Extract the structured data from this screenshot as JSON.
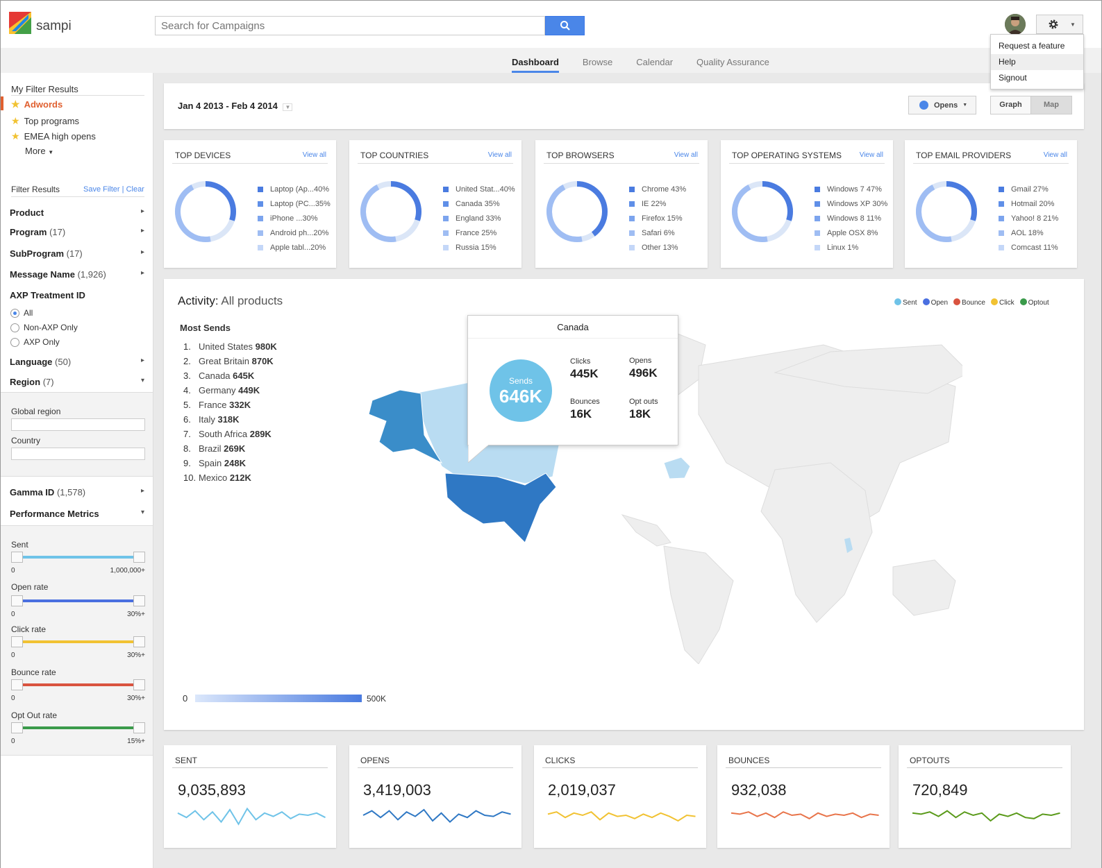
{
  "app": {
    "name": "sampi"
  },
  "search": {
    "placeholder": "Search for Campaigns"
  },
  "user_menu": {
    "items": [
      "Request a feature",
      "Help",
      "Signout"
    ]
  },
  "nav": {
    "tabs": [
      "Dashboard",
      "Browse",
      "Calendar",
      "Quality Assurance"
    ],
    "active": "Dashboard"
  },
  "sidebar": {
    "my_filters_title": "My Filter Results",
    "my_filters": [
      "Adwords",
      "Top programs",
      "EMEA high opens"
    ],
    "more": "More",
    "filter_results_title": "Filter Results",
    "save_filter": "Save Filter",
    "clear": "Clear",
    "facets": [
      {
        "name": "Product",
        "count": ""
      },
      {
        "name": "Program",
        "count": "(17)"
      },
      {
        "name": "SubProgram",
        "count": "(17)"
      },
      {
        "name": "Message Name",
        "count": "(1,926)"
      }
    ],
    "axp_title": "AXP Treatment ID",
    "axp_options": [
      "All",
      "Non-AXP Only",
      "AXP Only"
    ],
    "language": {
      "name": "Language",
      "count": "(50)"
    },
    "region": {
      "name": "Region",
      "count": "(7)"
    },
    "global_region_label": "Global region",
    "country_label": "Country",
    "gamma": {
      "name": "Gamma ID",
      "count": "(1,578)"
    },
    "performance_title": "Performance Metrics",
    "sliders": [
      {
        "label": "Sent",
        "min": "0",
        "max": "1,000,000+",
        "color": "#6fc3e8"
      },
      {
        "label": "Open rate",
        "min": "0",
        "max": "30%+",
        "color": "#4a6fe0"
      },
      {
        "label": "Click rate",
        "min": "0",
        "max": "30%+",
        "color": "#f1c232"
      },
      {
        "label": "Bounce rate",
        "min": "0",
        "max": "30%+",
        "color": "#d9533f"
      },
      {
        "label": "Opt Out rate",
        "min": "0",
        "max": "15%+",
        "color": "#3a9a4a"
      }
    ]
  },
  "toolbar": {
    "date_range": "Jan 4 2013 - Feb 4 2014",
    "metric": "Opens",
    "view_graph": "Graph",
    "view_map": "Map"
  },
  "panels": [
    {
      "title": "TOP DEVICES",
      "view_all": "View all",
      "items": [
        "Laptop (Ap...40%",
        "Laptop (PC...35%",
        "iPhone ...30%",
        "Android ph...20%",
        "Apple tabl...20%"
      ]
    },
    {
      "title": "TOP COUNTRIES",
      "view_all": "View all",
      "items": [
        "United Stat...40%",
        "Canada 35%",
        "England 33%",
        "France 25%",
        "Russia 15%"
      ]
    },
    {
      "title": "TOP BROWSERS",
      "view_all": "View all",
      "items": [
        "Chrome  43%",
        "IE 22%",
        "Firefox 15%",
        "Safari 6%",
        "Other 13%"
      ]
    },
    {
      "title": "TOP OPERATING SYSTEMS",
      "view_all": "View all",
      "items": [
        "Windows 7 47%",
        "Windows XP 30%",
        "Windows 8 11%",
        "Apple OSX 8%",
        "Linux 1%"
      ]
    },
    {
      "title": "TOP EMAIL PROVIDERS",
      "view_all": "View all",
      "items": [
        "Gmail 27%",
        "Hotmail 20%",
        "Yahoo! 8 21%",
        "AOL 18%",
        "Comcast 11%"
      ]
    }
  ],
  "legend_colors": [
    "#4a7be0",
    "#5f8fe8",
    "#7ca4ee",
    "#9fbdf3",
    "#c4d7f8"
  ],
  "activity": {
    "title_prefix": "Activity:",
    "title_value": "All products",
    "legend": [
      {
        "name": "Sent",
        "color": "#6fc3e8"
      },
      {
        "name": "Open",
        "color": "#4a6fe0"
      },
      {
        "name": "Bounce",
        "color": "#d9533f"
      },
      {
        "name": "Click",
        "color": "#f1c232"
      },
      {
        "name": "Optout",
        "color": "#3a9a4a"
      }
    ],
    "most_sends_title": "Most Sends",
    "most_sends": [
      {
        "rank": "1.",
        "name": "United States",
        "value": "980K"
      },
      {
        "rank": "2.",
        "name": "Great Britain",
        "value": "870K"
      },
      {
        "rank": "3.",
        "name": "Canada",
        "value": "645K"
      },
      {
        "rank": "4.",
        "name": "Germany",
        "value": "449K"
      },
      {
        "rank": "5.",
        "name": "France",
        "value": "332K"
      },
      {
        "rank": "6.",
        "name": "Italy",
        "value": "318K"
      },
      {
        "rank": "7.",
        "name": "South Africa",
        "value": "289K"
      },
      {
        "rank": "8.",
        "name": "Brazil",
        "value": "269K"
      },
      {
        "rank": "9.",
        "name": "Spain",
        "value": "248K"
      },
      {
        "rank": "10.",
        "name": "Mexico",
        "value": "212K"
      }
    ],
    "tooltip": {
      "country": "Canada",
      "sends_label": "Sends",
      "sends": "646K",
      "clicks_label": "Clicks",
      "clicks": "445K",
      "opens_label": "Opens",
      "opens": "496K",
      "bounces_label": "Bounces",
      "bounces": "16K",
      "optouts_label": "Opt outs",
      "optouts": "18K"
    },
    "scale_min": "0",
    "scale_max": "500K"
  },
  "kpis": [
    {
      "title": "SENT",
      "value": "9,035,893",
      "color": "#6fc3e8"
    },
    {
      "title": "OPENS",
      "value": "3,419,003",
      "color": "#2f78c4"
    },
    {
      "title": "CLICKS",
      "value": "2,019,037",
      "color": "#f1c232"
    },
    {
      "title": "BOUNCES",
      "value": "932,038",
      "color": "#e8744a"
    },
    {
      "title": "OPTOUTS",
      "value": "720,849",
      "color": "#5a9a1a"
    }
  ]
}
